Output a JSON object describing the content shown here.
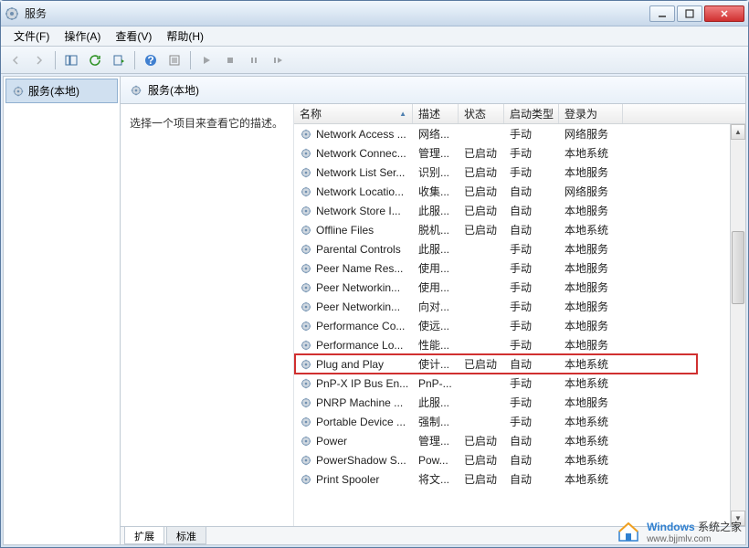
{
  "window": {
    "title": "服务"
  },
  "menu": {
    "file": "文件(F)",
    "action": "操作(A)",
    "view": "查看(V)",
    "help": "帮助(H)"
  },
  "tree": {
    "root": "服务(本地)"
  },
  "right_header": "服务(本地)",
  "desc_pane": {
    "text": "选择一个项目来查看它的描述。"
  },
  "columns": {
    "name": "名称",
    "desc": "描述",
    "status": "状态",
    "startup": "启动类型",
    "logon": "登录为"
  },
  "tabs": {
    "extended": "扩展",
    "standard": "标准"
  },
  "watermark": {
    "brand": "Windows",
    "sub": "系统之家",
    "url": "www.bjjmlv.com"
  },
  "services": [
    {
      "name": "Network Access ...",
      "desc": "网络...",
      "status": "",
      "startup": "手动",
      "logon": "网络服务"
    },
    {
      "name": "Network Connec...",
      "desc": "管理...",
      "status": "已启动",
      "startup": "手动",
      "logon": "本地系统"
    },
    {
      "name": "Network List Ser...",
      "desc": "识别...",
      "status": "已启动",
      "startup": "手动",
      "logon": "本地服务"
    },
    {
      "name": "Network Locatio...",
      "desc": "收集...",
      "status": "已启动",
      "startup": "自动",
      "logon": "网络服务"
    },
    {
      "name": "Network Store I...",
      "desc": "此服...",
      "status": "已启动",
      "startup": "自动",
      "logon": "本地服务"
    },
    {
      "name": "Offline Files",
      "desc": "脱机...",
      "status": "已启动",
      "startup": "自动",
      "logon": "本地系统"
    },
    {
      "name": "Parental Controls",
      "desc": "此服...",
      "status": "",
      "startup": "手动",
      "logon": "本地服务"
    },
    {
      "name": "Peer Name Res...",
      "desc": "使用...",
      "status": "",
      "startup": "手动",
      "logon": "本地服务"
    },
    {
      "name": "Peer Networkin...",
      "desc": "使用...",
      "status": "",
      "startup": "手动",
      "logon": "本地服务"
    },
    {
      "name": "Peer Networkin...",
      "desc": "向对...",
      "status": "",
      "startup": "手动",
      "logon": "本地服务"
    },
    {
      "name": "Performance Co...",
      "desc": "使远...",
      "status": "",
      "startup": "手动",
      "logon": "本地服务"
    },
    {
      "name": "Performance Lo...",
      "desc": "性能...",
      "status": "",
      "startup": "手动",
      "logon": "本地服务"
    },
    {
      "name": "Plug and Play",
      "desc": "使计...",
      "status": "已启动",
      "startup": "自动",
      "logon": "本地系统"
    },
    {
      "name": "PnP-X IP Bus En...",
      "desc": "PnP-...",
      "status": "",
      "startup": "手动",
      "logon": "本地系统"
    },
    {
      "name": "PNRP Machine ...",
      "desc": "此服...",
      "status": "",
      "startup": "手动",
      "logon": "本地服务"
    },
    {
      "name": "Portable Device ...",
      "desc": "强制...",
      "status": "",
      "startup": "手动",
      "logon": "本地系统"
    },
    {
      "name": "Power",
      "desc": "管理...",
      "status": "已启动",
      "startup": "自动",
      "logon": "本地系统"
    },
    {
      "name": "PowerShadow S...",
      "desc": "Pow...",
      "status": "已启动",
      "startup": "自动",
      "logon": "本地系统"
    },
    {
      "name": "Print Spooler",
      "desc": "将文...",
      "status": "已启动",
      "startup": "自动",
      "logon": "本地系统"
    }
  ]
}
